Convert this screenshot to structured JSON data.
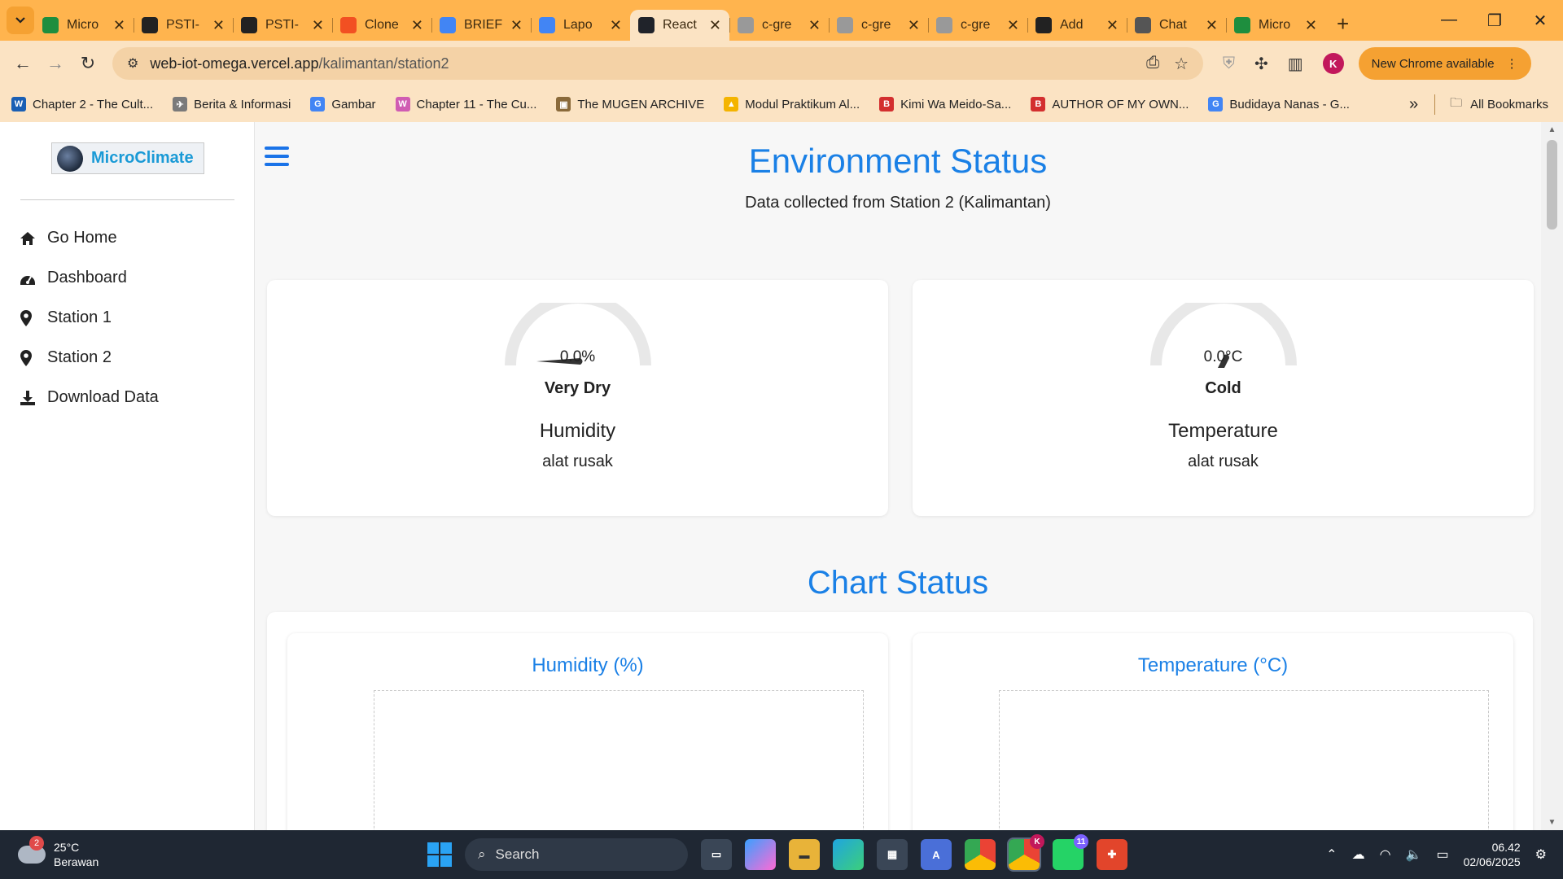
{
  "browser": {
    "tabs": [
      {
        "label": "Micro",
        "icon": "sheets-icon",
        "color": "#1e8e3e"
      },
      {
        "label": "PSTI-",
        "icon": "github-icon",
        "color": "#222"
      },
      {
        "label": "PSTI-",
        "icon": "github-icon",
        "color": "#222"
      },
      {
        "label": "Clone",
        "icon": "microsoft-icon",
        "color": "#f25022"
      },
      {
        "label": "BRIEF",
        "icon": "docs-icon",
        "color": "#4285f4"
      },
      {
        "label": "Lapo",
        "icon": "docs-icon",
        "color": "#4285f4"
      },
      {
        "label": "React",
        "icon": "react-icon",
        "color": "#20232a",
        "active": true
      },
      {
        "label": "c-gre",
        "icon": "globe-icon",
        "color": "#999"
      },
      {
        "label": "c-gre",
        "icon": "globe-icon",
        "color": "#999"
      },
      {
        "label": "c-gre",
        "icon": "globe-icon",
        "color": "#999"
      },
      {
        "label": "Add",
        "icon": "github-icon",
        "color": "#222"
      },
      {
        "label": "Chat",
        "icon": "chat-icon",
        "color": "#555"
      },
      {
        "label": "Micro",
        "icon": "sheets-icon",
        "color": "#1e8e3e"
      }
    ],
    "url_host": "web-iot-omega.vercel.app",
    "url_path": "/kalimantan/station2",
    "profile_initial": "K",
    "update_label": "New Chrome available",
    "bookmarks": [
      {
        "label": "Chapter 2 - The Cult...",
        "icon": "wattpad-icon",
        "color": "#1a5fb4",
        "glyph": "W"
      },
      {
        "label": "Berita & Informasi",
        "icon": "rocket-icon",
        "color": "#7a7a7a",
        "glyph": "✈"
      },
      {
        "label": "Gambar",
        "icon": "google-icon",
        "color": "#4285f4",
        "glyph": "G"
      },
      {
        "label": "Chapter 11 - The Cu...",
        "icon": "bookmark-site-icon",
        "color": "#d05cb3",
        "glyph": "W"
      },
      {
        "label": "The MUGEN ARCHIVE",
        "icon": "box-icon",
        "color": "#8a6a3a",
        "glyph": "▣"
      },
      {
        "label": "Modul Praktikum Al...",
        "icon": "drive-icon",
        "color": "#f4b400",
        "glyph": "▲"
      },
      {
        "label": "Kimi Wa Meido-Sa...",
        "icon": "blogger-icon",
        "color": "#d32f2f",
        "glyph": "B"
      },
      {
        "label": "AUTHOR OF MY OWN...",
        "icon": "blogger-icon",
        "color": "#d32f2f",
        "glyph": "B"
      },
      {
        "label": "Budidaya Nanas - G...",
        "icon": "google-icon",
        "color": "#4285f4",
        "glyph": "G"
      }
    ],
    "all_bookmarks_label": "All Bookmarks"
  },
  "sidebar": {
    "logo_text": "MicroClimate",
    "items": [
      {
        "label": "Go Home",
        "icon": "home-icon"
      },
      {
        "label": "Dashboard",
        "icon": "dashboard-icon"
      },
      {
        "label": "Station 1",
        "icon": "map-pin-icon"
      },
      {
        "label": "Station 2",
        "icon": "map-pin-icon"
      },
      {
        "label": "Download Data",
        "icon": "download-icon"
      }
    ]
  },
  "main": {
    "title": "Environment Status",
    "subtitle": "Data collected from Station 2 (Kalimantan)",
    "gauges": [
      {
        "value_text": "0.0%",
        "state": "Very Dry",
        "name": "Humidity",
        "note": "alat rusak",
        "level": 0.0,
        "needle": "left"
      },
      {
        "value_text": "0.0°C",
        "state": "Cold",
        "name": "Temperature",
        "note": "alat rusak",
        "level": 0.0,
        "needle": "down"
      }
    ],
    "chart_section_title": "Chart Status",
    "charts": [
      {
        "title": "Humidity (%)"
      },
      {
        "title": "Temperature (°C)"
      }
    ]
  },
  "taskbar": {
    "weather_temp": "25°C",
    "weather_desc": "Berawan",
    "weather_badge": "2",
    "search_placeholder": "Search",
    "time": "06.42",
    "date": "02/06/2025",
    "whatsapp_badge": "11",
    "chrome_badge": "K"
  }
}
